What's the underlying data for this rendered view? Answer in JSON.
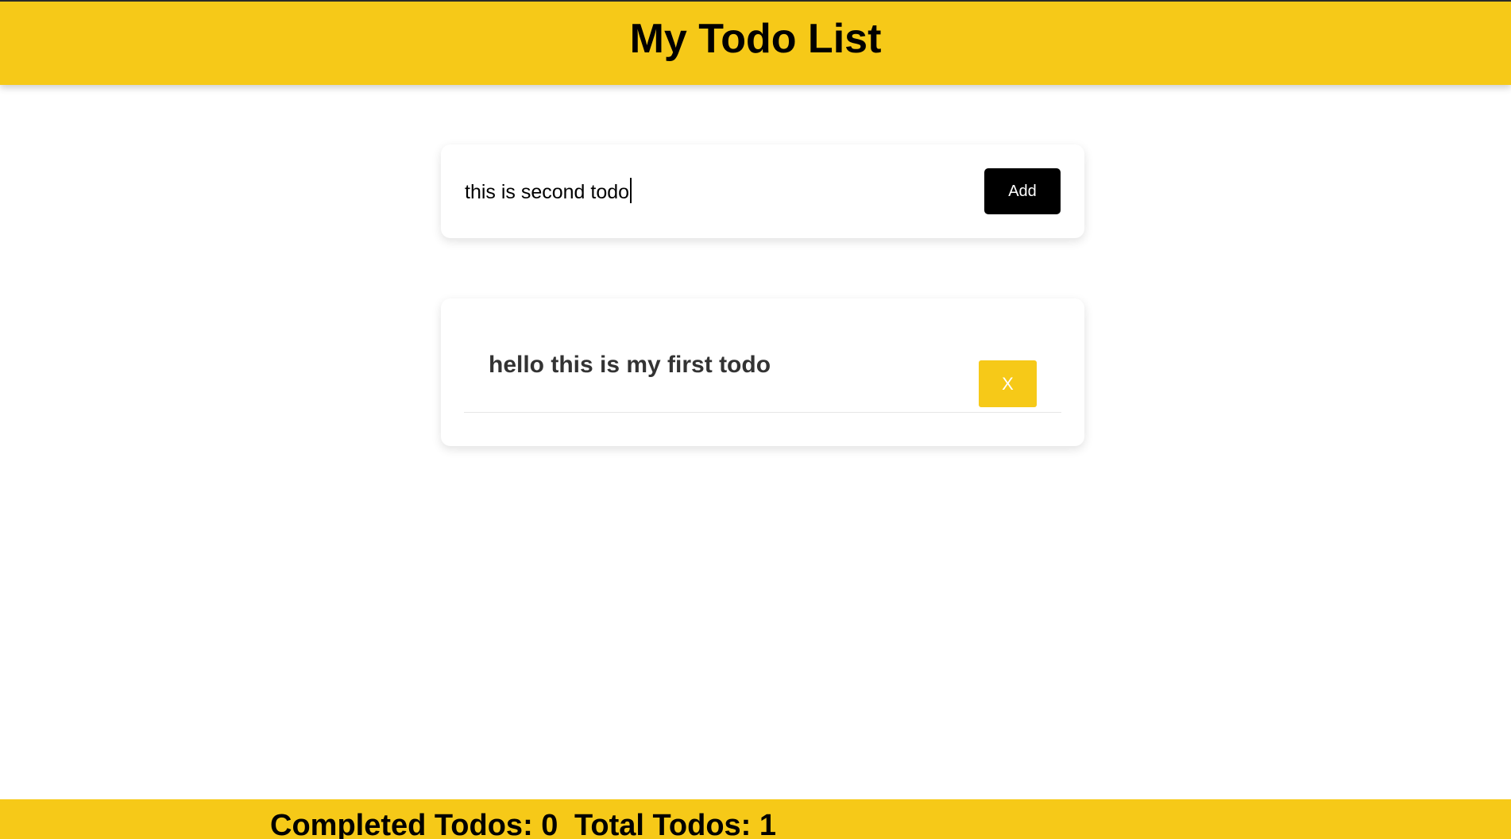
{
  "header": {
    "title": "My Todo List"
  },
  "input": {
    "value": "this is second todo",
    "add_label": "Add"
  },
  "todos": [
    {
      "text": "hello this is my first todo",
      "delete_label": "X"
    }
  ],
  "footer": {
    "completed": "Completed Todos: 0",
    "total": "Total Todos: 1"
  },
  "colors": {
    "accent": "#f6c918",
    "text": "#333333"
  }
}
